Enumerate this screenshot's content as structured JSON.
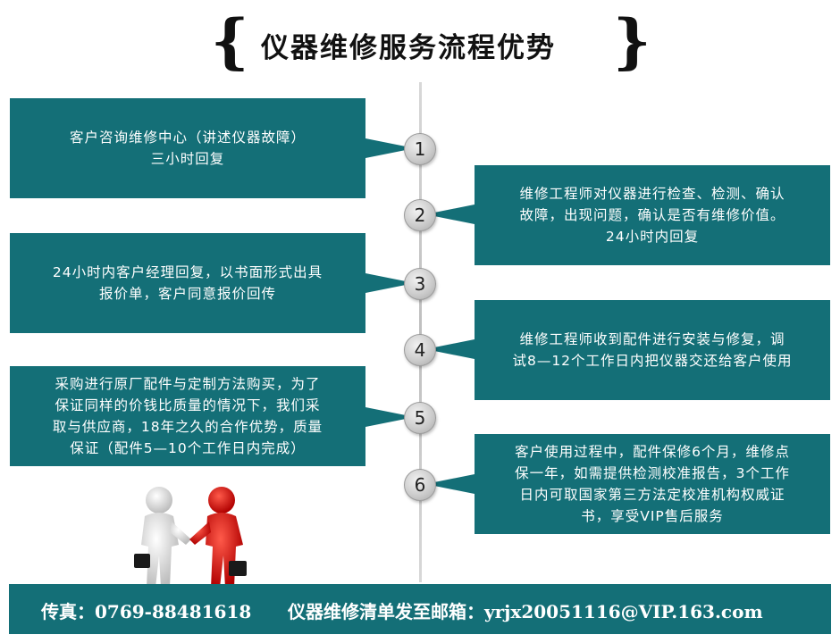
{
  "title": "仪器维修服务流程优势",
  "steps": [
    {
      "num": "1",
      "lines": [
        "客户咨询维修中心（讲述仪器故障）",
        "三小时回复"
      ]
    },
    {
      "num": "2",
      "lines": [
        "维修工程师对仪器进行检查、检测、确认",
        "故障，出现问题，确认是否有维修价值。",
        "24小时内回复"
      ]
    },
    {
      "num": "3",
      "lines": [
        "24小时内客户经理回复，以书面形式出具",
        "报价单，客户同意报价回传"
      ]
    },
    {
      "num": "4",
      "lines": [
        "维修工程师收到配件进行安装与修复，调",
        "试8—12个工作日内把仪器交还给客户使用"
      ]
    },
    {
      "num": "5",
      "lines": [
        "采购进行原厂配件与定制方法购买，为了",
        "保证同样的价钱比质量的情况下，我们采",
        "取与供应商，18年之久的合作优势，质量",
        "保证（配件5—10个工作日内完成）"
      ]
    },
    {
      "num": "6",
      "lines": [
        "客户使用过程中，配件保修6个月，维修点",
        "保一年，如需提供检测校准报告，3个工作",
        "日内可取国家第三方法定校准机构权威证",
        "书，享受VIP售后服务"
      ]
    }
  ],
  "footer": {
    "fax": "传真：0769-88481618",
    "mail": "仪器维修清单发至邮箱：yrjx20051116@VIP.163.com"
  },
  "colors": {
    "box": "#146f77",
    "handshake_left": "#e6e6e6",
    "handshake_right": "#e01010"
  }
}
